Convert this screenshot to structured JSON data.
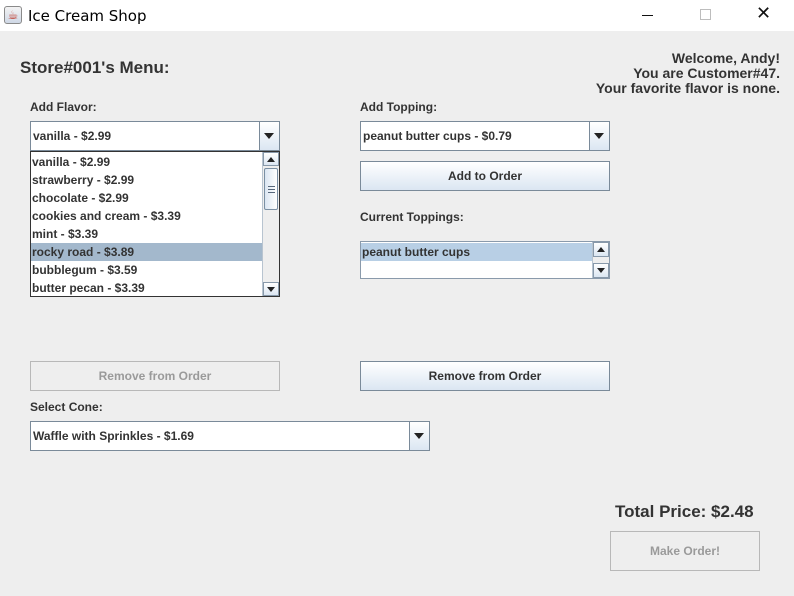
{
  "window": {
    "title": "Ice Cream Shop",
    "app_icon": "java-cup-icon",
    "controls": [
      "minimize-icon",
      "maximize-icon",
      "close-icon"
    ]
  },
  "store_menu_title": "Store#001's Menu:",
  "welcome": {
    "line1": "Welcome, Andy!",
    "line2": "You are Customer#47.",
    "line3": "Your favorite flavor is none."
  },
  "flavor": {
    "label": "Add Flavor:",
    "selected": "vanilla - $2.99",
    "items": [
      "vanilla - $2.99",
      "strawberry - $2.99",
      "chocolate - $2.99",
      "cookies and cream - $3.39",
      "mint - $3.39",
      "rocky road - $3.89",
      "bubblegum - $3.59",
      "butter pecan - $3.39"
    ],
    "highlighted": "rocky road - $3.89",
    "remove_button": "Remove from Order"
  },
  "topping": {
    "label": "Add Topping:",
    "selected": "peanut butter cups - $0.79",
    "add_button": "Add to Order",
    "current_label": "Current Toppings:",
    "current_items": [
      "peanut butter cups"
    ],
    "remove_button": "Remove from Order"
  },
  "cone": {
    "label": "Select Cone:",
    "selected": "Waffle with Sprinkles - $1.69"
  },
  "total": {
    "text": "Total Price: $2.48"
  },
  "make_order_button": "Make Order!",
  "colors": {
    "background": "#eeeeee",
    "selection": "#a3b8cc",
    "button_gradient_top": "#ffffff",
    "button_gradient_bottom": "#dbe6f2"
  }
}
